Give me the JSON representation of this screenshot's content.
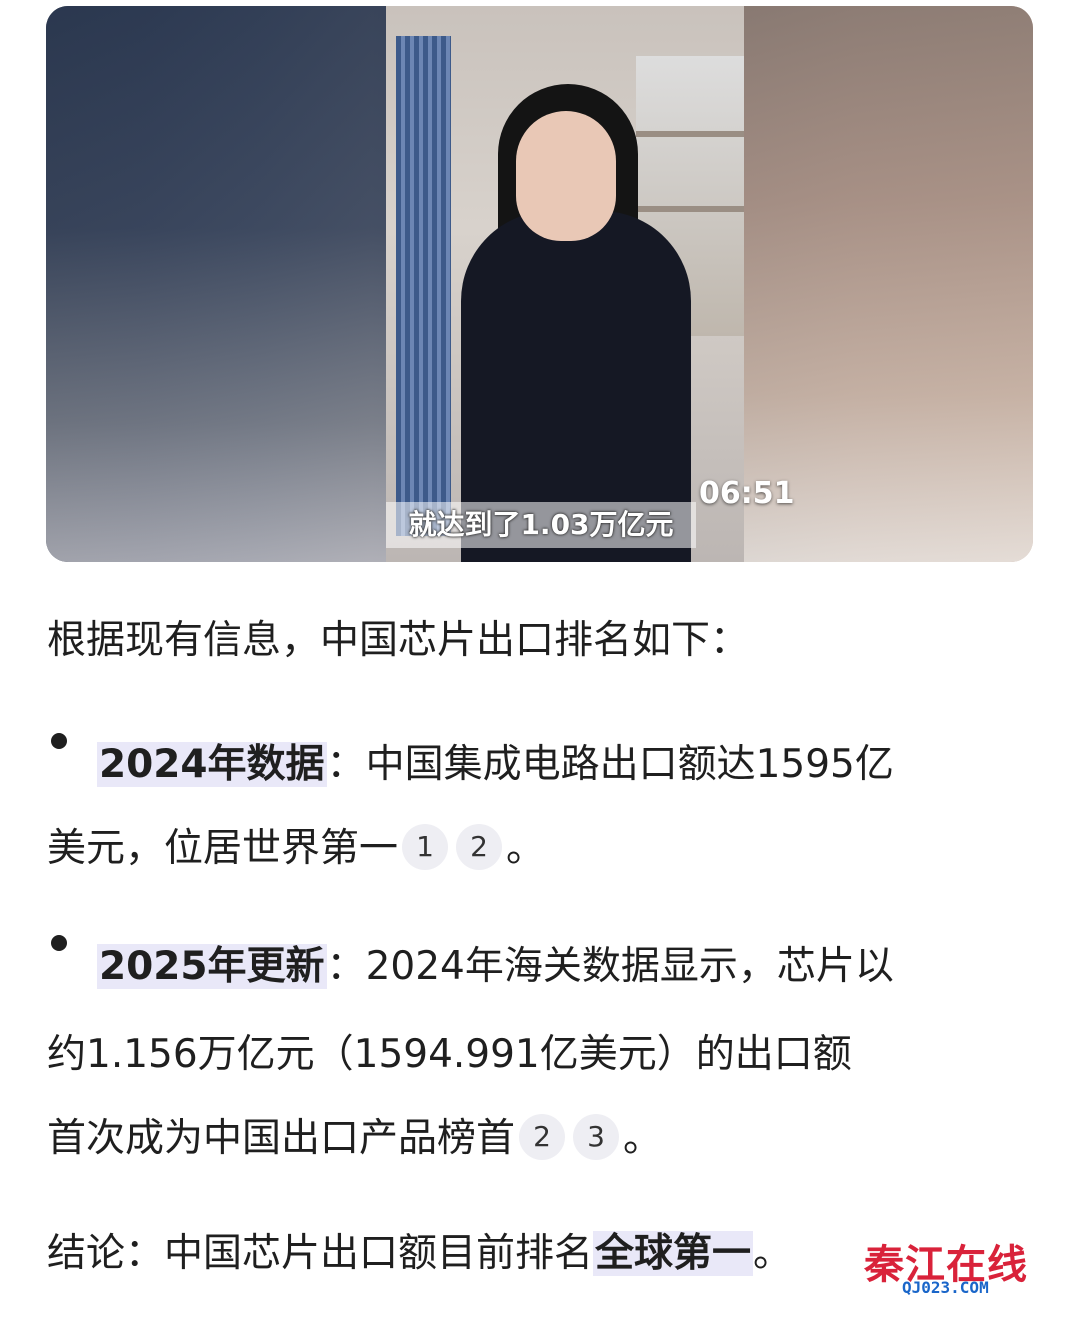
{
  "video": {
    "subtitle": "就达到了1.03万亿元",
    "duration": "06:51"
  },
  "article": {
    "intro": "根据现有信息，中国芯片出口排名如下：",
    "bullets": [
      {
        "label": "2024年数据",
        "sep": "：",
        "line1_text": "中国集成电路出口额达1595亿",
        "line2_text": "美元，位居世界第一",
        "citations": [
          "1",
          "2"
        ],
        "end": "。"
      },
      {
        "label": "2025年更新",
        "sep": "：",
        "line1_text": "2024年海关数据显示，芯片以",
        "line2_text": "约1.156万亿元（1594.991亿美元）的出口额",
        "line3_text": "首次成为中国出口产品榜首",
        "citations": [
          "2",
          "3"
        ],
        "end": "。"
      }
    ],
    "conclusion_prefix": "结论：中国芯片出口额目前排名",
    "conclusion_highlight": "全球第一",
    "conclusion_end": "。"
  },
  "watermark": {
    "text": "秦江在线",
    "url": "QJ023.COM"
  }
}
